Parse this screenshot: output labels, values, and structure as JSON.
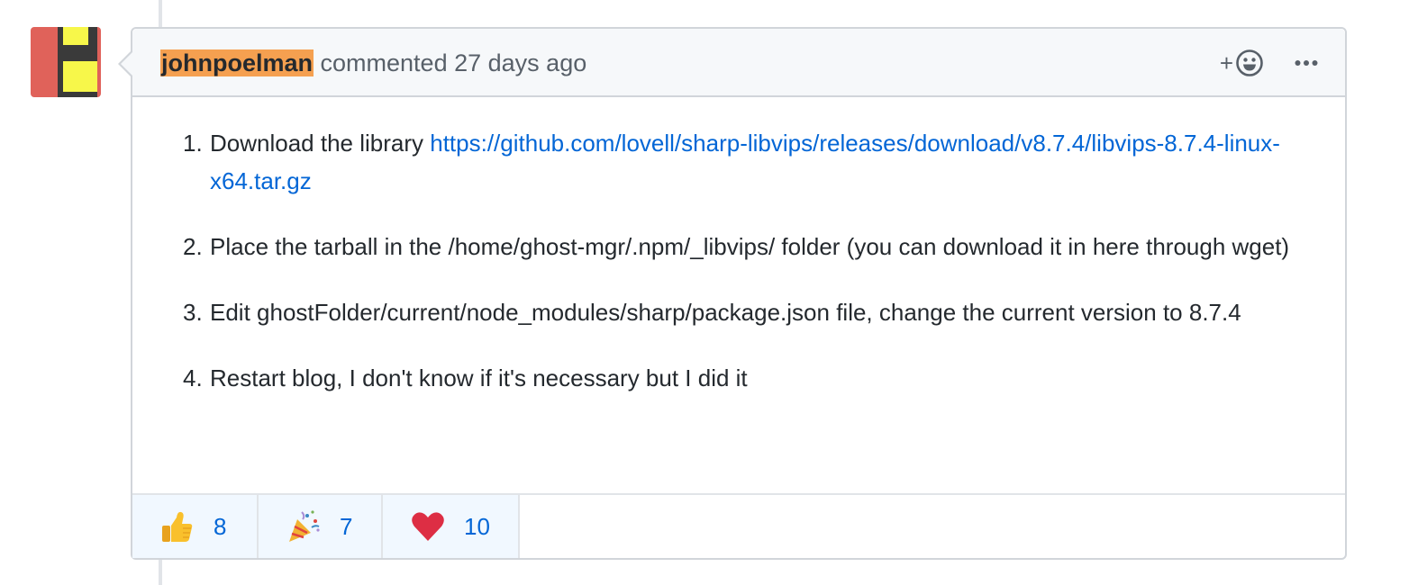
{
  "comment": {
    "author": "johnpoelman",
    "action": "commented",
    "time": "27 days ago",
    "add_reaction_label": "+",
    "steps": [
      {
        "text": "Download the library ",
        "link": "https://github.com/lovell/sharp-libvips/releases/download/v8.7.4/libvips-8.7.4-linux-x64.tar.gz"
      },
      {
        "text": "Place the tarball in the /home/ghost-mgr/.npm/_libvips/ folder (you can download it in here through wget)"
      },
      {
        "text": "Edit ghostFolder/current/node_modules/sharp/package.json file, change the current version to 8.7.4"
      },
      {
        "text": "Restart blog, I don't know if it's necessary but I did it"
      }
    ]
  },
  "reactions": [
    {
      "icon": "thumbs-up-icon",
      "count": "8"
    },
    {
      "icon": "party-popper-icon",
      "count": "7"
    },
    {
      "icon": "heart-icon",
      "count": "10"
    }
  ],
  "colors": {
    "link": "#0366d6",
    "author_highlight": "#f5a050",
    "header_bg": "#f6f8fa",
    "reaction_bg": "#f1f8ff"
  }
}
